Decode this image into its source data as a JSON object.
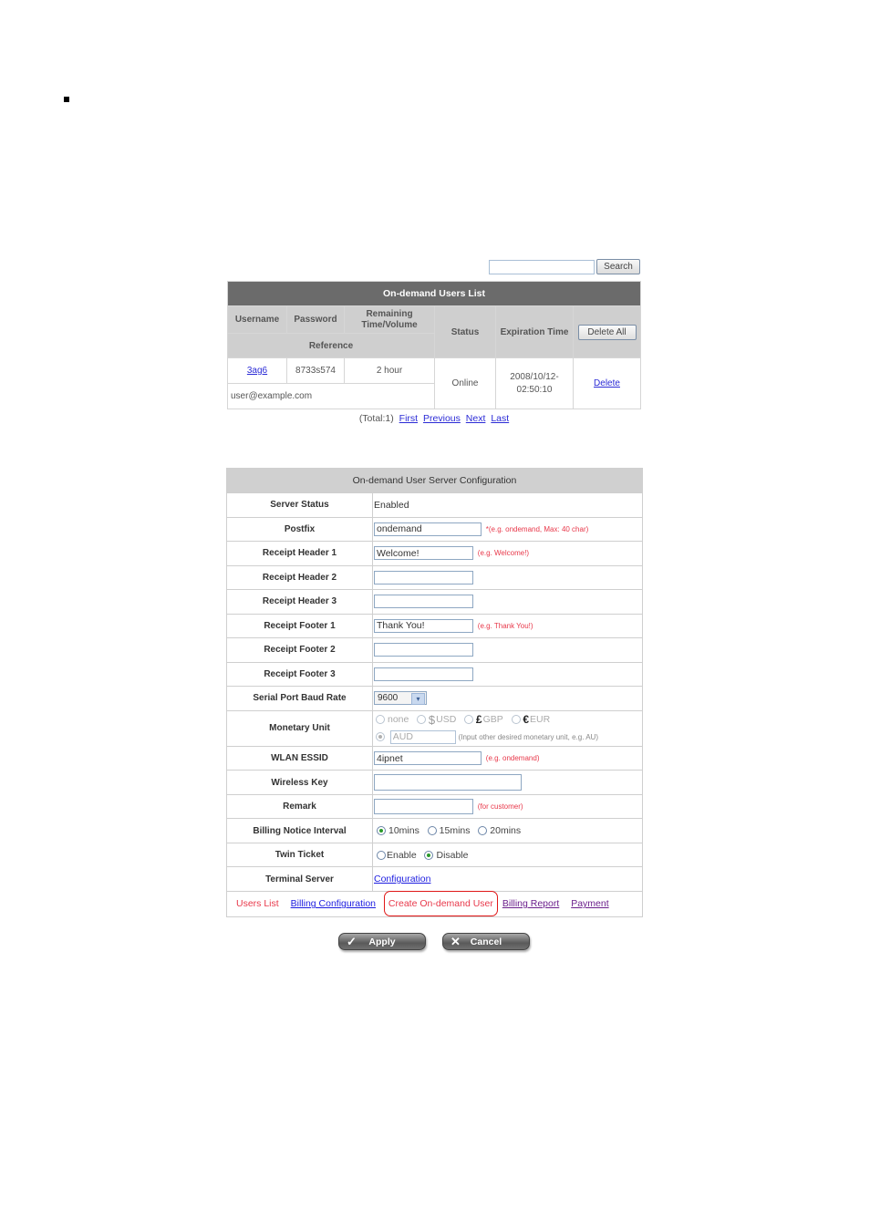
{
  "search": {
    "placeholder": "",
    "value": "",
    "button_label": "Search"
  },
  "users_list": {
    "title": "On-demand Users List",
    "headers": {
      "username": "Username",
      "password": "Password",
      "remaining": "Remaining Time/Volume",
      "reference": "Reference",
      "status": "Status",
      "expiration": "Expiration Time",
      "delete_all": "Delete All"
    },
    "rows": [
      {
        "username": "3ag6",
        "password": "8733s574",
        "remaining": "2 hour",
        "reference": "user@example.com",
        "status": "Online",
        "expiration": "2008/10/12-02:50:10",
        "action": "Delete"
      }
    ],
    "pager": {
      "total": "(Total:1)",
      "first": "First",
      "previous": "Previous",
      "next": "Next",
      "last": "Last"
    }
  },
  "config": {
    "title": "On-demand User Server Configuration",
    "server_status": {
      "label": "Server Status",
      "value": "Enabled"
    },
    "postfix": {
      "label": "Postfix",
      "value": "ondemand",
      "hint": "*(e.g. ondemand, Max: 40 char)"
    },
    "receipt_header_1": {
      "label": "Receipt Header 1",
      "value": "Welcome!",
      "hint": "(e.g. Welcome!)"
    },
    "receipt_header_2": {
      "label": "Receipt Header 2",
      "value": ""
    },
    "receipt_header_3": {
      "label": "Receipt Header 3",
      "value": ""
    },
    "receipt_footer_1": {
      "label": "Receipt Footer 1",
      "value": "Thank You!",
      "hint": "(e.g. Thank You!)"
    },
    "receipt_footer_2": {
      "label": "Receipt Footer 2",
      "value": ""
    },
    "receipt_footer_3": {
      "label": "Receipt Footer 3",
      "value": ""
    },
    "baud_rate": {
      "label": "Serial Port Baud Rate",
      "value": "9600"
    },
    "monetary_unit": {
      "label": "Monetary Unit",
      "options": [
        {
          "symbol": "",
          "label": "none",
          "selected": false
        },
        {
          "symbol": "$",
          "label": "USD",
          "selected": false
        },
        {
          "symbol": "£",
          "label": "GBP",
          "selected": false
        },
        {
          "symbol": "€",
          "label": "EUR",
          "selected": false
        }
      ],
      "other_value": "AUD",
      "other_selected": true,
      "other_hint": "(Input other desired monetary unit, e.g. AU)"
    },
    "wlan_essid": {
      "label": "WLAN ESSID",
      "value": "4ipnet",
      "hint": "(e.g. ondemand)"
    },
    "wireless_key": {
      "label": "Wireless Key",
      "value": ""
    },
    "remark": {
      "label": "Remark",
      "value": "",
      "hint": "(for customer)"
    },
    "billing_notice": {
      "label": "Billing Notice Interval",
      "options": [
        {
          "label": "10mins",
          "selected": true
        },
        {
          "label": "15mins",
          "selected": false
        },
        {
          "label": "20mins",
          "selected": false
        }
      ]
    },
    "twin_ticket": {
      "label": "Twin Ticket",
      "options": [
        {
          "label": "Enable",
          "selected": false
        },
        {
          "label": "Disable",
          "selected": true
        }
      ]
    },
    "terminal_server": {
      "label": "Terminal Server",
      "link": "Configuration"
    },
    "nav": {
      "users_list": "Users List",
      "billing_configuration": "Billing Configuration",
      "create_user": "Create On-demand User",
      "billing_report": "Billing Report",
      "payment": "Payment"
    }
  },
  "actions": {
    "apply": "Apply",
    "cancel": "Cancel"
  },
  "icons": {
    "apply": "✓",
    "cancel": "✕",
    "dropdown": "▾"
  },
  "colors": {
    "title_bar": "#6b6b6b",
    "header_bg": "#cfcfcf",
    "hint_red": "#e8384a",
    "link_blue": "#1d1de0",
    "visited_purple": "#6b1f8c"
  }
}
